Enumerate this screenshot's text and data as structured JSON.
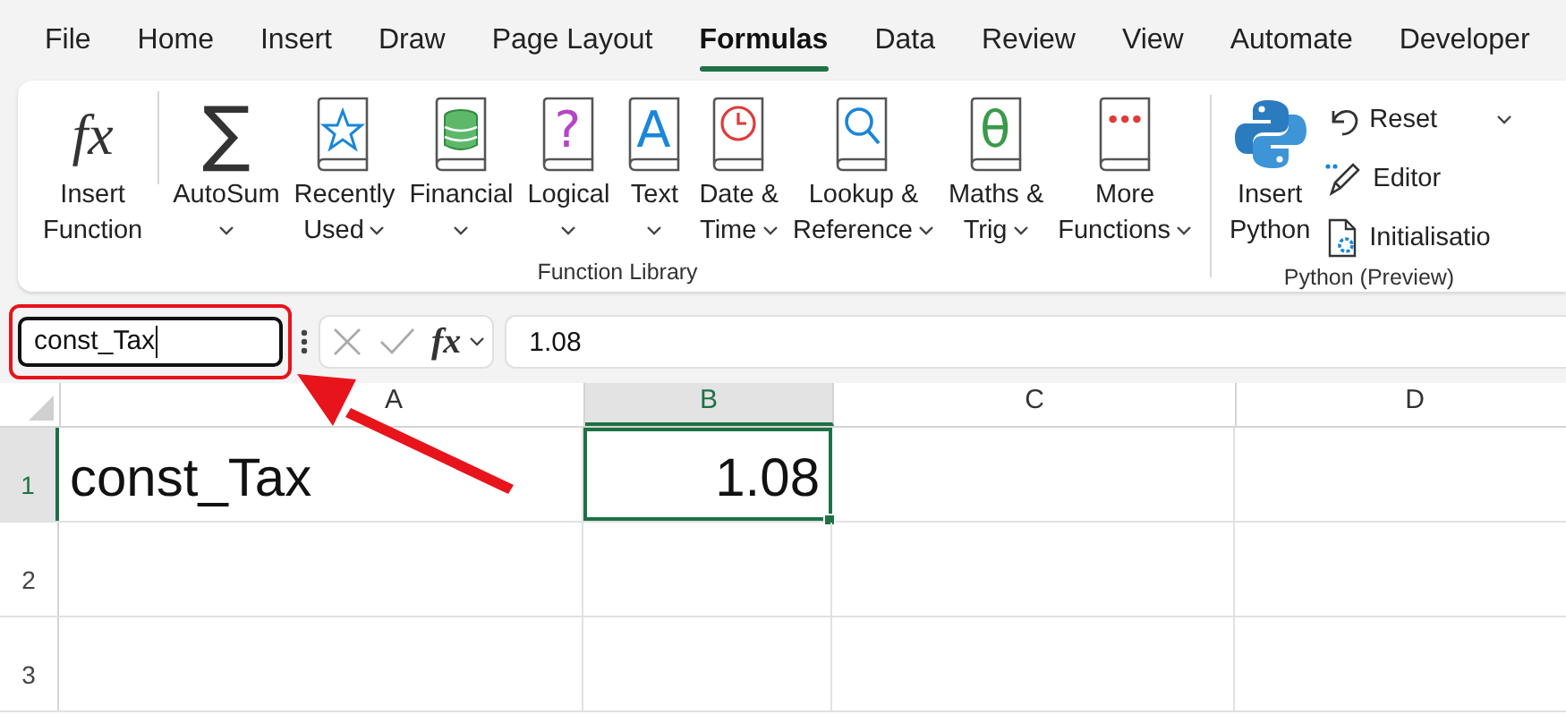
{
  "menu": [
    {
      "label": "File",
      "selected": false
    },
    {
      "label": "Home",
      "selected": false
    },
    {
      "label": "Insert",
      "selected": false
    },
    {
      "label": "Draw",
      "selected": false
    },
    {
      "label": "Page Layout",
      "selected": false
    },
    {
      "label": "Formulas",
      "selected": true
    },
    {
      "label": "Data",
      "selected": false
    },
    {
      "label": "Review",
      "selected": false
    },
    {
      "label": "View",
      "selected": false
    },
    {
      "label": "Automate",
      "selected": false
    },
    {
      "label": "Developer",
      "selected": false
    }
  ],
  "ribbon": {
    "groups": [
      {
        "title": "Function Library",
        "buttons": [
          {
            "glyph": "fx",
            "lines": [
              "Insert",
              "Function"
            ],
            "dropdown": false
          },
          {
            "glyph": "∑",
            "lines": [
              "AutoSum"
            ],
            "dropdown": true
          },
          {
            "lines": [
              "Recently",
              "Used"
            ],
            "dropdown": true
          },
          {
            "lines": [
              "Financial"
            ],
            "dropdown": true
          },
          {
            "glyph": "?",
            "lines": [
              "Logical"
            ],
            "dropdown": true
          },
          {
            "glyph": "A",
            "lines": [
              "Text"
            ],
            "dropdown": true
          },
          {
            "lines": [
              "Date &",
              "Time"
            ],
            "dropdown": true
          },
          {
            "lines": [
              "Lookup &",
              "Reference"
            ],
            "dropdown": true
          },
          {
            "glyph": "θ",
            "lines": [
              "Maths &",
              "Trig"
            ],
            "dropdown": true
          },
          {
            "glyph": "•••",
            "lines": [
              "More",
              "Functions"
            ],
            "dropdown": true
          }
        ]
      },
      {
        "title": "Python (Preview)",
        "buttons": [
          {
            "lines": [
              "Insert",
              "Python"
            ],
            "dropdown": false
          }
        ],
        "small_buttons": [
          {
            "label": "Reset",
            "dropdown": true
          },
          {
            "label": "Editor",
            "dropdown": false
          },
          {
            "label": "Initialisatio",
            "dropdown": false
          }
        ]
      }
    ]
  },
  "formula_bar": {
    "name_box": "const_Tax",
    "function_glyph": "fx",
    "formula": "1.08"
  },
  "sheet": {
    "columns": [
      {
        "label": "A",
        "selected": false
      },
      {
        "label": "B",
        "selected": true
      },
      {
        "label": "C",
        "selected": false
      },
      {
        "label": "D",
        "selected": false
      }
    ],
    "rows": [
      {
        "label": "1",
        "selected": true,
        "cells": [
          {
            "text": "const_Tax",
            "selected": false
          },
          {
            "text": "1.08",
            "selected": true
          }
        ]
      },
      {
        "label": "2",
        "selected": false
      },
      {
        "label": "3",
        "selected": false
      }
    ]
  },
  "annotations": {
    "highlight_box": true,
    "arrow": true
  }
}
